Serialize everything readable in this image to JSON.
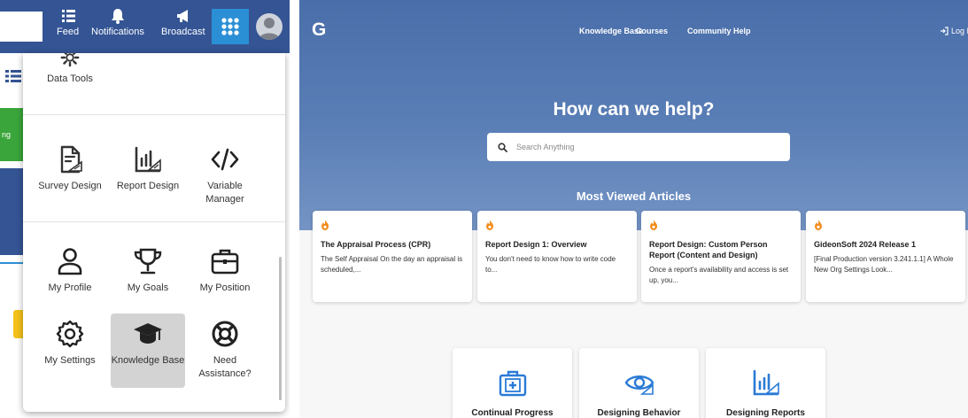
{
  "left_app": {
    "topbar": {
      "feed_label": "Feed",
      "notifications_label": "Notifications",
      "broadcast_label": "Broadcast"
    },
    "background_tab_fragment": "ng",
    "dropdown": {
      "sections": [
        {
          "items": [
            {
              "label": "Data Tools",
              "icon": "gear-icon"
            }
          ]
        },
        {
          "items": [
            {
              "label": "Survey Design",
              "icon": "survey-design-icon"
            },
            {
              "label": "Report Design",
              "icon": "report-design-icon"
            },
            {
              "label": "Variable Manager",
              "icon": "code-icon"
            }
          ]
        },
        {
          "items": [
            {
              "label": "My Profile",
              "icon": "person-icon"
            },
            {
              "label": "My Goals",
              "icon": "trophy-icon"
            },
            {
              "label": "My Position",
              "icon": "briefcase-icon"
            },
            {
              "label": "My Settings",
              "icon": "settings-icon"
            },
            {
              "label": "Knowledge Base",
              "icon": "graduation-cap-icon",
              "active": true
            },
            {
              "label": "Need Assistance?",
              "icon": "lifebuoy-icon"
            }
          ]
        }
      ]
    },
    "colors": {
      "topbar": "#345494",
      "apps_button": "#2b8fd6",
      "active_tile": "#d3d3d3"
    }
  },
  "help_site": {
    "logo": "G",
    "nav": [
      "Knowledge Base",
      "Courses",
      "Community Help"
    ],
    "login_label": "Log In",
    "hero_title": "How can we help?",
    "search_placeholder": "Search Anything",
    "most_viewed_title": "Most Viewed Articles",
    "articles": [
      {
        "title": "The Appraisal Process (CPR)",
        "excerpt": "The Self Appraisal On the day an appraisal is scheduled,..."
      },
      {
        "title": "Report Design 1: Overview",
        "excerpt": "You don't need to know how to write code to..."
      },
      {
        "title": "Report Design: Custom Person Report (Content and Design)",
        "excerpt": "Once a report's availability and access is set up, you..."
      },
      {
        "title": "GideonSoft 2024 Release 1",
        "excerpt": "[Final Production version 3.241.1.1] A Whole New Org Settings Look..."
      }
    ],
    "categories": [
      {
        "label": "Continual Progress",
        "icon": "medkit-icon"
      },
      {
        "label": "Designing Behavior",
        "icon": "eye-icon"
      },
      {
        "label": "Designing Reports",
        "icon": "report-chart-icon"
      }
    ],
    "colors": {
      "hero": "#4a6ea9",
      "accent_flame": "#f28c1b"
    }
  }
}
